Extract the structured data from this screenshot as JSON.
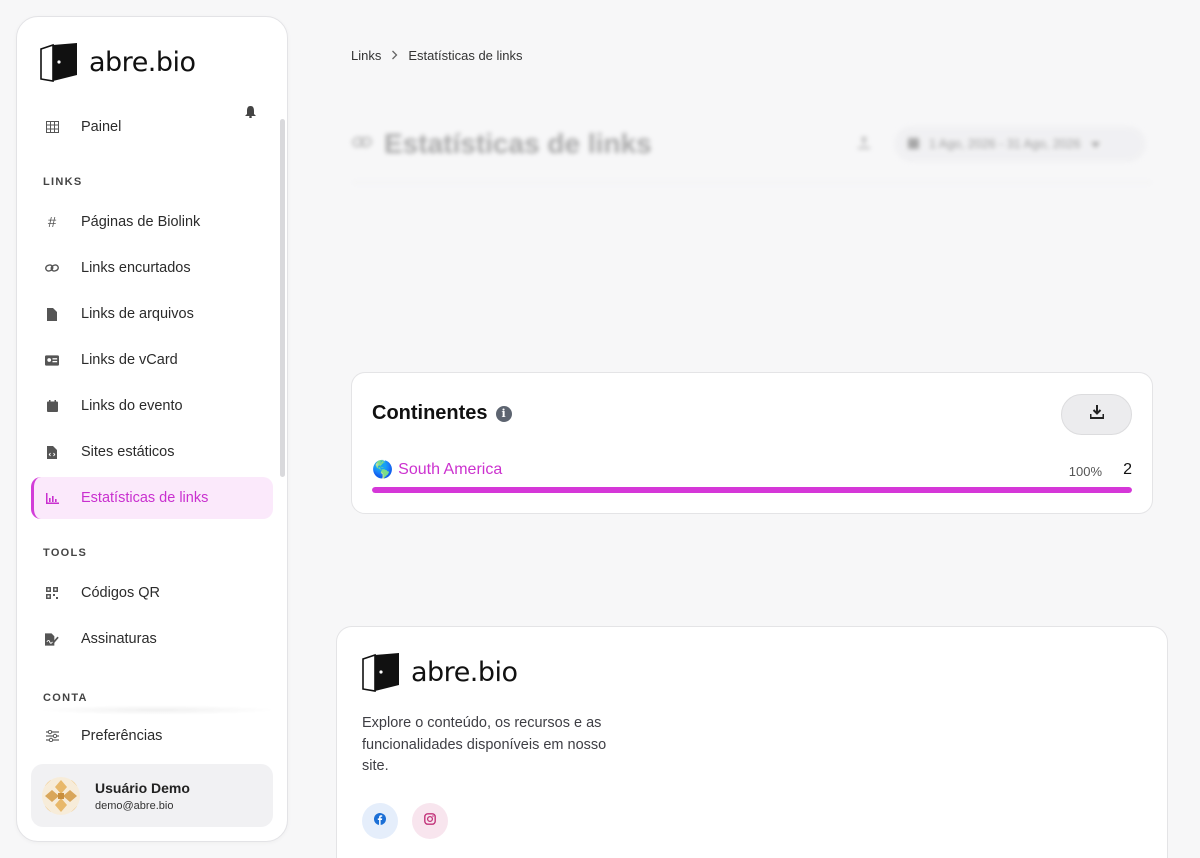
{
  "brand": {
    "name": "abre.bio"
  },
  "sidebar": {
    "top_item": {
      "label": "Painel",
      "icon": "table-icon"
    },
    "sections": [
      {
        "label": "LINKS"
      },
      {
        "label": "TOOLS"
      },
      {
        "label": "CONTA"
      }
    ],
    "links_items": [
      {
        "label": "Páginas de Biolink",
        "icon": "hash-icon"
      },
      {
        "label": "Links encurtados",
        "icon": "link-icon"
      },
      {
        "label": "Links de arquivos",
        "icon": "file-icon"
      },
      {
        "label": "Links de vCard",
        "icon": "id-card-icon"
      },
      {
        "label": "Links do evento",
        "icon": "calendar-icon"
      },
      {
        "label": "Sites estáticos",
        "icon": "file-code-icon"
      },
      {
        "label": "Estatísticas de links",
        "icon": "chart-icon",
        "active": true
      }
    ],
    "tools_items": [
      {
        "label": "Códigos QR",
        "icon": "qrcode-icon"
      },
      {
        "label": "Assinaturas",
        "icon": "signature-icon"
      }
    ],
    "conta_items": [
      {
        "label": "Preferências",
        "icon": "sliders-icon"
      }
    ],
    "user": {
      "name": "Usuário Demo",
      "email": "demo@abre.bio"
    }
  },
  "breadcrumb": {
    "root": "Links",
    "current": "Estatísticas de links"
  },
  "header": {
    "title": "Estatísticas de links",
    "date_range": "1 Ago, 2026 - 31 Ago, 2026"
  },
  "continents_card": {
    "title": "Continentes",
    "rows": [
      {
        "label": "South America",
        "percent_label": "100%",
        "count": "2",
        "fraction": 1.0
      }
    ]
  },
  "footer": {
    "brand": "abre.bio",
    "description": "Explore o conteúdo, os recursos e as funcionalidades disponíveis em nosso site.",
    "social": [
      "facebook-icon",
      "instagram-icon"
    ]
  },
  "colors": {
    "accent": "#d537d8",
    "accent_text": "#cc32cf",
    "active_bg": "#fbe9fb"
  }
}
